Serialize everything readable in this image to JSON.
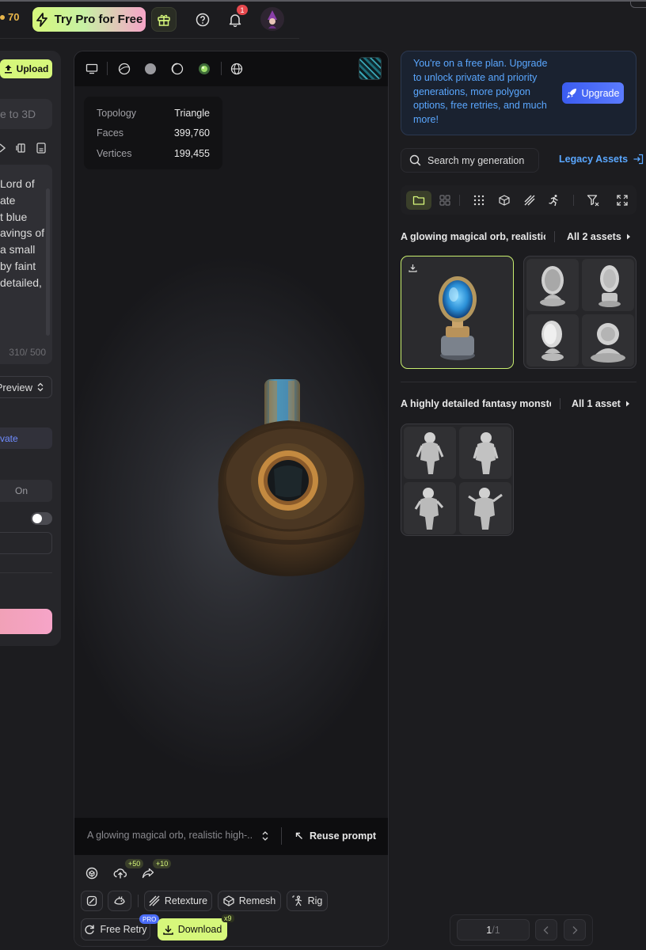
{
  "header": {
    "credits": "70",
    "try_pro_label": "Try Pro for Free",
    "notifications_count": "1"
  },
  "left_panel": {
    "upload_label": "Upload",
    "mode_placeholder": "e to 3D",
    "prompt_text": "Lord of\nate\nt blue\navings of\na small\nby faint\ndetailed,",
    "char_count": "310/ 500",
    "quality_value": "Preview",
    "visibility_label": "vate",
    "toggle_label": "On"
  },
  "viewer": {
    "stats": [
      {
        "key": "Topology",
        "value": "Triangle"
      },
      {
        "key": "Faces",
        "value": "399,760"
      },
      {
        "key": "Vertices",
        "value": "199,455"
      }
    ],
    "prompt_preview": "A glowing magical orb, realistic high-...",
    "reuse_label": "Reuse prompt",
    "upload_bonus": "+50",
    "share_bonus": "+10",
    "tools": {
      "retexture": "Retexture",
      "remesh": "Remesh",
      "rig": "Rig",
      "free_retry": "Free Retry",
      "pro_badge": "PRO",
      "download": "Download",
      "download_count": "x9"
    }
  },
  "banner": {
    "text": "You're on a free plan. Upgrade to unlock private and priority generations, more polygon options, free retries, and much more!",
    "upgrade_label": "Upgrade"
  },
  "search": {
    "placeholder": "Search my generation",
    "legacy_label": "Legacy Assets"
  },
  "groups": [
    {
      "title": "A glowing magical orb, realistic ...",
      "all_label": "All 2 assets"
    },
    {
      "title": "A highly detailed fantasy monster ...",
      "all_label": "All 1 asset"
    }
  ],
  "pagination": {
    "current": "1",
    "total": "/1"
  },
  "colors": {
    "accent_lime": "#d6f77b",
    "accent_blue": "#5aa7ff",
    "upgrade_blue": "#4a6cf7",
    "badge_red": "#e5484d"
  }
}
